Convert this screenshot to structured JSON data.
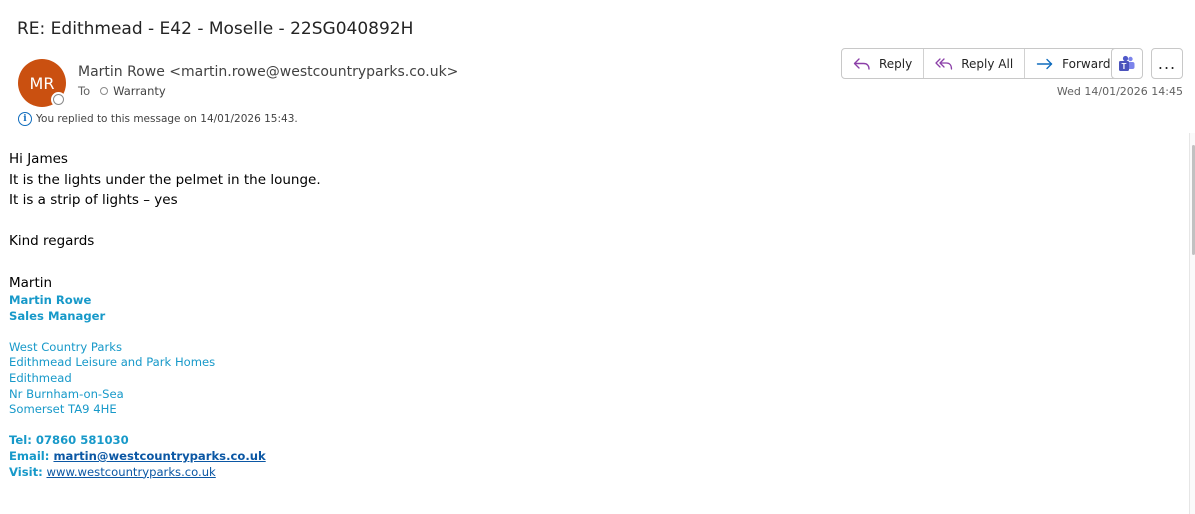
{
  "email": {
    "subject": "RE: Edithmead - E42 - Moselle - 22SG040892H",
    "sender": {
      "initials": "MR",
      "display": "Martin Rowe <martin.rowe@westcountryparks.co.uk>",
      "avatar_color": "#ca5010"
    },
    "to_label": "To",
    "recipient": "Warranty",
    "replied_notice": "You replied to this message on 14/01/2026 15:43.",
    "date": "Wed 14/01/2026 14:45"
  },
  "actions": {
    "reply": "Reply",
    "reply_all": "Reply All",
    "forward": "Forward",
    "teams_icon": "teams-icon",
    "more_icon": "more-icon",
    "more_label": "..."
  },
  "body": {
    "greeting": "Hi James",
    "line1": "It is the lights under the pelmet in the lounge.",
    "line2": "It is a strip of lights – yes",
    "closing": "Kind regards",
    "signoff": "Martin"
  },
  "signature": {
    "name": "Martin Rowe",
    "title": "Sales Manager",
    "address": [
      "West Country Parks",
      "Edithmead Leisure and Park Homes",
      "Edithmead",
      "Nr Burnham-on-Sea",
      "Somerset TA9 4HE"
    ],
    "tel": "Tel: 07860 581030",
    "email_label": "Email:",
    "email_value": "martin@westcountryparks.co.uk",
    "visit_label": "Visit:",
    "visit_value": "www.westcountryparks.co.uk",
    "color": "#1799c9"
  }
}
